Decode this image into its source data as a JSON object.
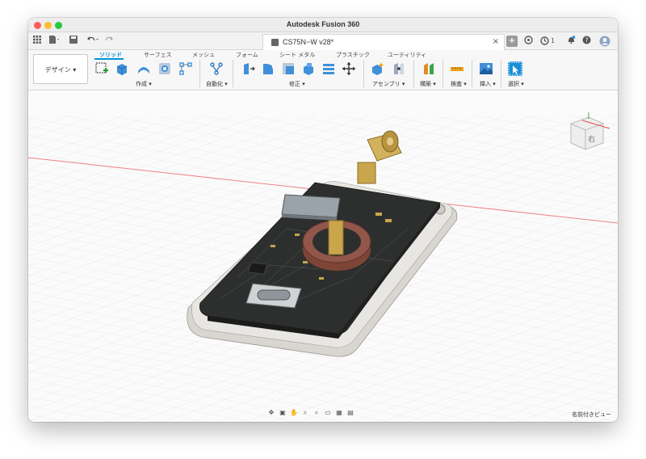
{
  "window": {
    "title": "Autodesk Fusion 360"
  },
  "document_tab": {
    "label": "CS75N−W v28*",
    "close_glyph": "×"
  },
  "top_right": {
    "job_count": "1",
    "add_glyph": "+"
  },
  "workspace": {
    "label": "デザイン ▾"
  },
  "ribbon_tabs": [
    {
      "label": "ソリッド",
      "active": true
    },
    {
      "label": "サーフェス",
      "active": false
    },
    {
      "label": "メッシュ",
      "active": false
    },
    {
      "label": "フォーム",
      "active": false
    },
    {
      "label": "シート メタル",
      "active": false
    },
    {
      "label": "プラスチック",
      "active": false
    },
    {
      "label": "ユーティリティ",
      "active": false
    }
  ],
  "tool_groups": {
    "create": "作成 ▾",
    "automate": "自動化 ▾",
    "modify": "修正 ▾",
    "assemble": "アセンブリ ▾",
    "construct": "構築 ▾",
    "inspect": "検査 ▾",
    "insert": "挿入 ▾",
    "select": "選択 ▾"
  },
  "viewport": {
    "named_views": "名前付きビュー",
    "viewcube_label": "右"
  },
  "colors": {
    "accent": "#0696d7",
    "pcb": "#2e2f2e",
    "case": "#e2e0dc",
    "axis_red": "#f08080",
    "connector_gold": "#c9a54b",
    "cell_holder": "#8a4c3e"
  }
}
